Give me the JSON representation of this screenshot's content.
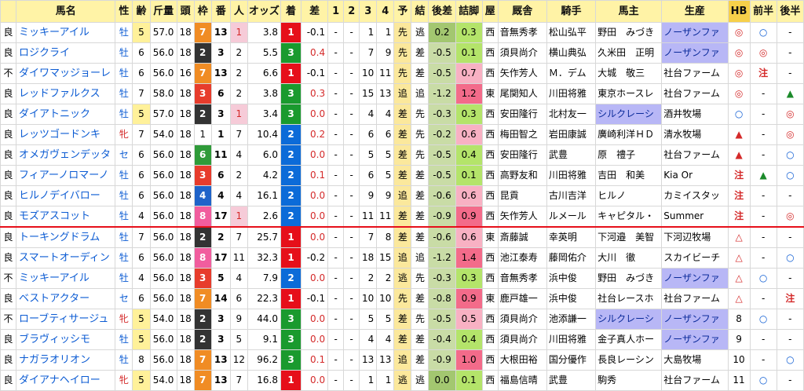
{
  "headers": [
    "馬名",
    "性",
    "齢",
    "斤量",
    "頭",
    "枠",
    "番",
    "人",
    "オッズ",
    "着",
    "差",
    "1",
    "2",
    "3",
    "4",
    "予",
    "結",
    "後差",
    "詰脚",
    "屋",
    "厩舎",
    "騎手",
    "馬主",
    "生産",
    "HB",
    "前半",
    "後半"
  ],
  "rows": [
    {
      "cond": "良",
      "name": "ミッキーアイル",
      "sex": "牡",
      "age": "5",
      "kin": "57.0",
      "tou": "18",
      "waku": "7",
      "ban": "13",
      "nin": "1",
      "odds": "3.8",
      "cha": "1",
      "sa": "-0.1",
      "c1": "-",
      "c2": "-",
      "c3": "1",
      "c4": "1",
      "yo": "先",
      "ke": "逃",
      "kosa": "0.2",
      "tsume": "0.3",
      "ya": "西",
      "kyu": "音無秀孝",
      "kishu": "松山弘平",
      "owner": "野田　みづき",
      "prod": "ノーザンファ",
      "hb": "◎",
      "zen": "○",
      "kou": "-"
    },
    {
      "cond": "良",
      "name": "ロジクライ",
      "sex": "牡",
      "age": "6",
      "kin": "56.0",
      "tou": "18",
      "waku": "2",
      "ban": "3",
      "nin": "2",
      "odds": "5.5",
      "cha": "3",
      "sa": "0.4",
      "c1": "-",
      "c2": "-",
      "c3": "7",
      "c4": "9",
      "yo": "先",
      "ke": "差",
      "kosa": "-0.5",
      "tsume": "0.1",
      "ya": "西",
      "kyu": "須貝尚介",
      "kishu": "横山典弘",
      "owner": "久米田　正明",
      "prod": "ノーザンファ",
      "hb": "◎",
      "zen": "◎",
      "kou": "-"
    },
    {
      "cond": "不",
      "name": "ダイワマッジョーレ",
      "sex": "牡",
      "age": "6",
      "kin": "56.0",
      "tou": "16",
      "waku": "7",
      "ban": "13",
      "nin": "2",
      "odds": "6.6",
      "cha": "1",
      "sa": "-0.1",
      "c1": "-",
      "c2": "-",
      "c3": "10",
      "c4": "11",
      "yo": "先",
      "ke": "差",
      "kosa": "-0.5",
      "tsume": "0.7",
      "ya": "西",
      "kyu": "矢作芳人",
      "kishu": "Ｍ．デム",
      "owner": "大城　敬三",
      "prod": "社台ファーム",
      "hb": "◎",
      "zen": "注",
      "kou": "-"
    },
    {
      "cond": "良",
      "name": "レッドファルクス",
      "sex": "牡",
      "age": "7",
      "kin": "58.0",
      "tou": "18",
      "waku": "3",
      "ban": "6",
      "nin": "2",
      "odds": "3.8",
      "cha": "3",
      "sa": "0.3",
      "c1": "-",
      "c2": "-",
      "c3": "15",
      "c4": "13",
      "yo": "追",
      "ke": "追",
      "kosa": "-1.2",
      "tsume": "1.2",
      "ya": "東",
      "kyu": "尾関知人",
      "kishu": "川田将雅",
      "owner": "東京ホースレ",
      "prod": "社台ファーム",
      "hb": "◎",
      "zen": "-",
      "kou": "▲"
    },
    {
      "cond": "良",
      "name": "ダイアトニック",
      "sex": "牡",
      "age": "5",
      "kin": "57.0",
      "tou": "18",
      "waku": "2",
      "ban": "3",
      "nin": "1",
      "odds": "3.4",
      "cha": "3",
      "sa": "0.0",
      "c1": "-",
      "c2": "-",
      "c3": "4",
      "c4": "4",
      "yo": "差",
      "ke": "先",
      "kosa": "-0.3",
      "tsume": "0.3",
      "ya": "西",
      "kyu": "安田隆行",
      "kishu": "北村友一",
      "owner": "シルクレーシ",
      "prod": "酒井牧場",
      "hb": "○",
      "zen": "-",
      "kou": "◎"
    },
    {
      "cond": "良",
      "name": "レッツゴードンキ",
      "sex": "牝",
      "age": "7",
      "kin": "54.0",
      "tou": "18",
      "waku": "1",
      "ban": "1",
      "nin": "7",
      "odds": "10.4",
      "cha": "2",
      "sa": "0.2",
      "c1": "-",
      "c2": "-",
      "c3": "6",
      "c4": "6",
      "yo": "差",
      "ke": "先",
      "kosa": "-0.2",
      "tsume": "0.6",
      "ya": "西",
      "kyu": "梅田智之",
      "kishu": "岩田康誠",
      "owner": "廣崎利洋ＨＤ",
      "prod": "清水牧場",
      "hb": "▲",
      "zen": "-",
      "kou": "◎"
    },
    {
      "cond": "良",
      "name": "オメガヴェンデッタ",
      "sex": "セ",
      "age": "6",
      "kin": "56.0",
      "tou": "18",
      "waku": "6",
      "ban": "11",
      "nin": "4",
      "odds": "6.0",
      "cha": "2",
      "sa": "0.0",
      "c1": "-",
      "c2": "-",
      "c3": "5",
      "c4": "5",
      "yo": "差",
      "ke": "先",
      "kosa": "-0.5",
      "tsume": "0.4",
      "ya": "西",
      "kyu": "安田隆行",
      "kishu": "武豊",
      "owner": "原　禮子",
      "prod": "社台ファーム",
      "hb": "▲",
      "zen": "-",
      "kou": "○"
    },
    {
      "cond": "良",
      "name": "フィアーノロマーノ",
      "sex": "牡",
      "age": "6",
      "kin": "56.0",
      "tou": "18",
      "waku": "3",
      "ban": "6",
      "nin": "2",
      "odds": "4.2",
      "cha": "2",
      "sa": "0.1",
      "c1": "-",
      "c2": "-",
      "c3": "6",
      "c4": "5",
      "yo": "差",
      "ke": "差",
      "kosa": "-0.5",
      "tsume": "0.1",
      "ya": "西",
      "kyu": "高野友和",
      "kishu": "川田将雅",
      "owner": "吉田　和美",
      "prod": "Kia Or",
      "hb": "注",
      "zen": "▲",
      "kou": "○"
    },
    {
      "cond": "良",
      "name": "ヒルノデイバロー",
      "sex": "牡",
      "age": "6",
      "kin": "56.0",
      "tou": "18",
      "waku": "4",
      "ban": "4",
      "nin": "4",
      "odds": "16.1",
      "cha": "2",
      "sa": "0.0",
      "c1": "-",
      "c2": "-",
      "c3": "9",
      "c4": "9",
      "yo": "追",
      "ke": "差",
      "kosa": "-0.6",
      "tsume": "0.6",
      "ya": "西",
      "kyu": "昆貢",
      "kishu": "古川吉洋",
      "owner": "ヒルノ",
      "prod": "カミイスタッ",
      "hb": "注",
      "zen": "-",
      "kou": "-"
    },
    {
      "cond": "良",
      "name": "モズアスコット",
      "sex": "牡",
      "age": "4",
      "kin": "56.0",
      "tou": "18",
      "waku": "8",
      "ban": "17",
      "nin": "1",
      "odds": "2.6",
      "cha": "2",
      "sa": "0.0",
      "c1": "-",
      "c2": "-",
      "c3": "11",
      "c4": "11",
      "yo": "差",
      "ke": "差",
      "kosa": "-0.9",
      "tsume": "0.9",
      "ya": "西",
      "kyu": "矢作芳人",
      "kishu": "ルメール",
      "owner": "キャピタル・",
      "prod": "Summer",
      "hb": "注",
      "zen": "-",
      "kou": "◎"
    },
    {
      "cond": "良",
      "name": "トーキングドラム",
      "sex": "牡",
      "age": "7",
      "kin": "56.0",
      "tou": "18",
      "waku": "2",
      "ban": "2",
      "nin": "7",
      "odds": "25.7",
      "cha": "1",
      "sa": "0.0",
      "c1": "-",
      "c2": "-",
      "c3": "7",
      "c4": "8",
      "yo": "差",
      "ke": "差",
      "kosa": "-0.6",
      "tsume": "0.6",
      "ya": "東",
      "kyu": "斎藤誠",
      "kishu": "幸英明",
      "owner": "下河邉　美智",
      "prod": "下河辺牧場",
      "hb": "△",
      "zen": "-",
      "kou": "-"
    },
    {
      "cond": "良",
      "name": "スマートオーディン",
      "sex": "牡",
      "age": "6",
      "kin": "56.0",
      "tou": "18",
      "waku": "8",
      "ban": "17",
      "nin": "11",
      "odds": "32.3",
      "cha": "1",
      "sa": "-0.2",
      "c1": "-",
      "c2": "-",
      "c3": "18",
      "c4": "15",
      "yo": "追",
      "ke": "追",
      "kosa": "-1.2",
      "tsume": "1.4",
      "ya": "西",
      "kyu": "池江泰寿",
      "kishu": "藤岡佑介",
      "owner": "大川　徹",
      "prod": "スカイビーチ",
      "hb": "△",
      "zen": "-",
      "kou": "○"
    },
    {
      "cond": "不",
      "name": "ミッキーアイル",
      "sex": "牡",
      "age": "4",
      "kin": "56.0",
      "tou": "18",
      "waku": "3",
      "ban": "5",
      "nin": "4",
      "odds": "7.9",
      "cha": "2",
      "sa": "0.0",
      "c1": "-",
      "c2": "-",
      "c3": "2",
      "c4": "2",
      "yo": "逃",
      "ke": "先",
      "kosa": "-0.3",
      "tsume": "0.3",
      "ya": "西",
      "kyu": "音無秀孝",
      "kishu": "浜中俊",
      "owner": "野田　みづき",
      "prod": "ノーザンファ",
      "hb": "△",
      "zen": "○",
      "kou": "-"
    },
    {
      "cond": "良",
      "name": "ベストアクター",
      "sex": "セ",
      "age": "6",
      "kin": "56.0",
      "tou": "18",
      "waku": "7",
      "ban": "14",
      "nin": "6",
      "odds": "22.3",
      "cha": "1",
      "sa": "-0.1",
      "c1": "-",
      "c2": "-",
      "c3": "10",
      "c4": "10",
      "yo": "先",
      "ke": "差",
      "kosa": "-0.8",
      "tsume": "0.9",
      "ya": "東",
      "kyu": "鹿戸雄一",
      "kishu": "浜中俊",
      "owner": "社台レースホ",
      "prod": "社台ファーム",
      "hb": "△",
      "zen": "-",
      "kou": "注"
    },
    {
      "cond": "不",
      "name": "ローブティサージュ",
      "sex": "牝",
      "age": "5",
      "kin": "54.0",
      "tou": "18",
      "waku": "2",
      "ban": "3",
      "nin": "9",
      "odds": "44.0",
      "cha": "3",
      "sa": "0.0",
      "c1": "-",
      "c2": "-",
      "c3": "5",
      "c4": "5",
      "yo": "差",
      "ke": "先",
      "kosa": "-0.5",
      "tsume": "0.5",
      "ya": "西",
      "kyu": "須貝尚介",
      "kishu": "池添謙一",
      "owner": "シルクレーシ",
      "prod": "ノーザンファ",
      "hb": "8",
      "zen": "○",
      "kou": "-"
    },
    {
      "cond": "良",
      "name": "ブラヴィッシモ",
      "sex": "牡",
      "age": "5",
      "kin": "56.0",
      "tou": "18",
      "waku": "2",
      "ban": "3",
      "nin": "5",
      "odds": "9.1",
      "cha": "3",
      "sa": "0.0",
      "c1": "-",
      "c2": "-",
      "c3": "4",
      "c4": "4",
      "yo": "差",
      "ke": "差",
      "kosa": "-0.4",
      "tsume": "0.4",
      "ya": "西",
      "kyu": "須貝尚介",
      "kishu": "川田将雅",
      "owner": "金子真人ホー",
      "prod": "ノーザンファ",
      "hb": "9",
      "zen": "-",
      "kou": "-"
    },
    {
      "cond": "良",
      "name": "ナガラオリオン",
      "sex": "牡",
      "age": "8",
      "kin": "56.0",
      "tou": "18",
      "waku": "7",
      "ban": "13",
      "nin": "12",
      "odds": "96.2",
      "cha": "3",
      "sa": "0.1",
      "c1": "-",
      "c2": "-",
      "c3": "13",
      "c4": "13",
      "yo": "追",
      "ke": "差",
      "kosa": "-0.9",
      "tsume": "1.0",
      "ya": "西",
      "kyu": "大根田裕",
      "kishu": "国分優作",
      "owner": "長良レーシン",
      "prod": "大島牧場",
      "hb": "10",
      "zen": "-",
      "kou": "○"
    },
    {
      "cond": "良",
      "name": "ダイアナヘイロー",
      "sex": "牝",
      "age": "5",
      "kin": "54.0",
      "tou": "18",
      "waku": "7",
      "ban": "13",
      "nin": "7",
      "odds": "16.8",
      "cha": "1",
      "sa": "0.0",
      "c1": "-",
      "c2": "-",
      "c3": "1",
      "c4": "1",
      "yo": "逃",
      "ke": "逃",
      "kosa": "0.0",
      "tsume": "0.1",
      "ya": "西",
      "kyu": "福島信晴",
      "kishu": "武豊",
      "owner": "駒秀",
      "prod": "社台ファーム",
      "hb": "11",
      "zen": "○",
      "kou": "-"
    }
  ],
  "colors": {
    "accent": "#e60f1a",
    "header_bg": "#fff3a6",
    "hb_bg": "#f7d04a",
    "lavender": "#b8b7f6"
  }
}
